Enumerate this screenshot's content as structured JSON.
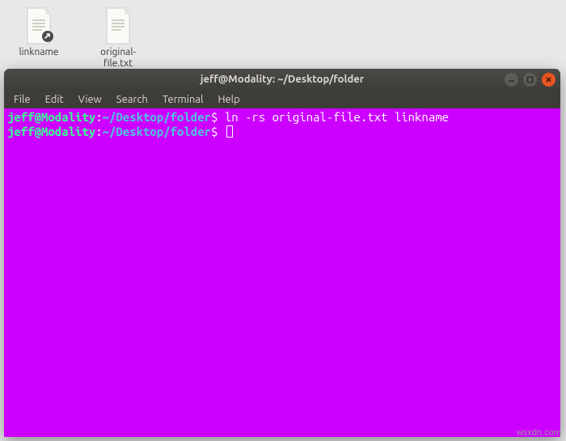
{
  "desktop": {
    "icons": [
      {
        "label": "linkname",
        "is_link": true
      },
      {
        "label": "original-file.txt",
        "is_link": false
      }
    ]
  },
  "window": {
    "title": "jeff@Modality: ~/Desktop/folder",
    "controls": {
      "minimize": "minimize-icon",
      "maximize": "maximize-icon",
      "close": "close-icon"
    }
  },
  "menubar": {
    "items": [
      "File",
      "Edit",
      "View",
      "Search",
      "Terminal",
      "Help"
    ]
  },
  "terminal": {
    "lines": [
      {
        "user_host": "jeff@Modality",
        "sep": ":",
        "path": "~/Desktop/folder",
        "dollar": "$",
        "command": "ln -rs original-file.txt linkname"
      },
      {
        "user_host": "jeff@Modality",
        "sep": ":",
        "path": "~/Desktop/folder",
        "dollar": "$",
        "command": ""
      }
    ]
  },
  "watermark": "wsxdn.com"
}
